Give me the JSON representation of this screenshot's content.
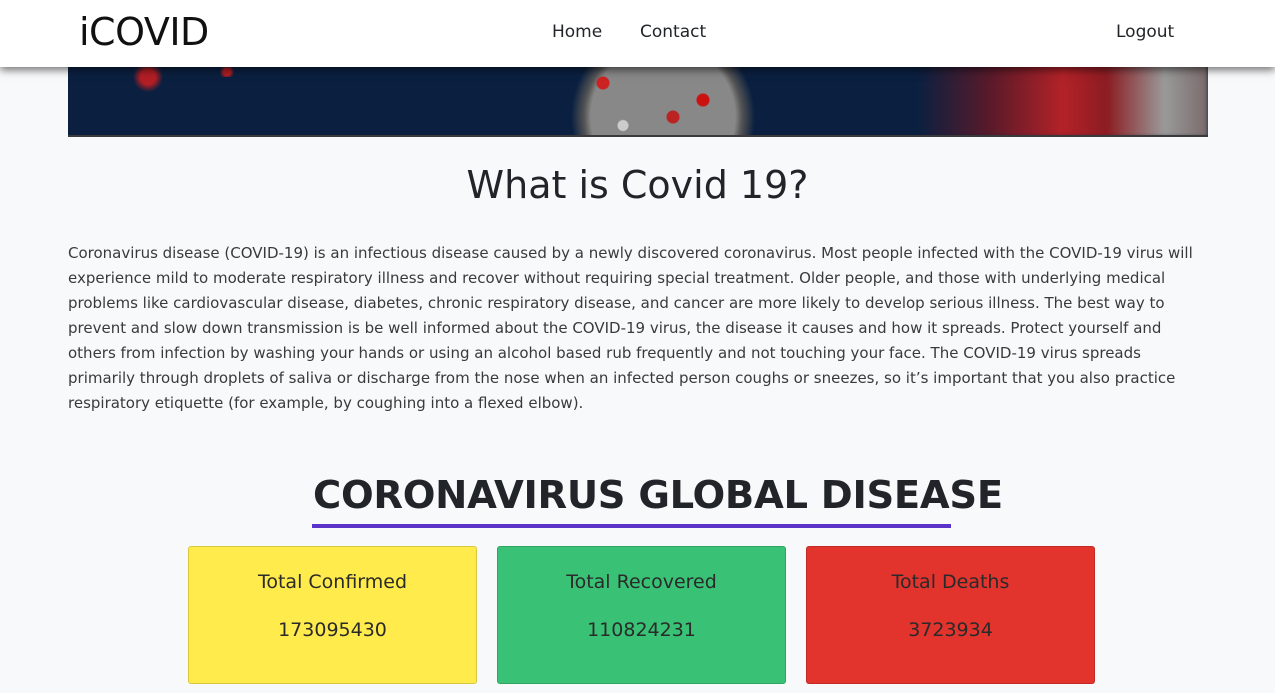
{
  "navbar": {
    "brand": "iCOVID",
    "links": [
      "Home",
      "Contact"
    ],
    "logout": "Logout"
  },
  "about": {
    "title": "What is Covid 19?",
    "text": "Coronavirus disease (COVID-19) is an infectious disease caused by a newly discovered coronavirus. Most people infected with the COVID-19 virus will experience mild to moderate respiratory illness and recover without requiring special treatment. Older people, and those with underlying medical problems like cardiovascular disease, diabetes, chronic respiratory disease, and cancer are more likely to develop serious illness. The best way to prevent and slow down transmission is be well informed about the COVID-19 virus, the disease it causes and how it spreads. Protect yourself and others from infection by washing your hands or using an alcohol based rub frequently and not touching your face. The COVID-19 virus spreads primarily through droplets of saliva or discharge from the nose when an infected person coughs or sneezes, so it’s important that you also practice respiratory etiquette (for example, by coughing into a flexed elbow)."
  },
  "global": {
    "title": "CORONAVIRUS GLOBAL DISEASE",
    "underline_color": "#5a34c8",
    "cards": [
      {
        "label": "Total Confirmed",
        "value": "173095430",
        "color": "#ffeb4b"
      },
      {
        "label": "Total Recovered",
        "value": "110824231",
        "color": "#39c275"
      },
      {
        "label": "Total Deaths",
        "value": "3723934",
        "color": "#e2332d"
      }
    ]
  },
  "colors": {
    "hero_bg": "#0b2040",
    "page_bg": "#f8f9fa"
  }
}
